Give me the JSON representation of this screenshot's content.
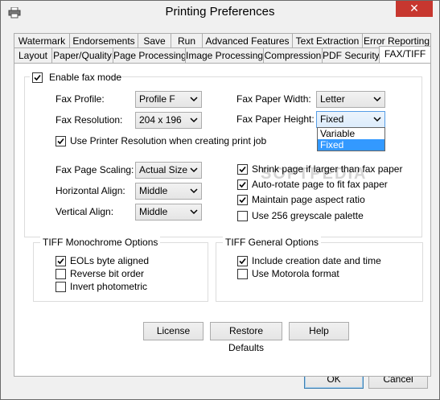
{
  "window": {
    "title": "Printing Preferences",
    "close_glyph": "✕"
  },
  "tabs_row1": [
    "Watermark",
    "Endorsements",
    "Save",
    "Run",
    "Advanced Features",
    "Text Extraction",
    "Error Reporting"
  ],
  "tabs_row2": [
    "Layout",
    "Paper/Quality",
    "Page Processing",
    "Image Processing",
    "Compression",
    "PDF Security",
    "FAX/TIFF"
  ],
  "active_tab": "FAX/TIFF",
  "fax": {
    "enable_label": "Enable fax mode",
    "enable_checked": true,
    "profile_label": "Fax Profile:",
    "profile_value": "Profile F",
    "resolution_label": "Fax Resolution:",
    "resolution_value": "204 x 196",
    "paper_width_label": "Fax Paper Width:",
    "paper_width_value": "Letter",
    "paper_height_label": "Fax Paper Height:",
    "paper_height_value": "Fixed",
    "paper_height_options": [
      "Variable",
      "Fixed"
    ],
    "paper_height_selected": "Fixed",
    "use_printer_res_label": "Use Printer Resolution when creating print job",
    "use_printer_res_checked": true,
    "scaling_label": "Fax Page Scaling:",
    "scaling_value": "Actual Size",
    "halign_label": "Horizontal Align:",
    "halign_value": "Middle",
    "valign_label": "Vertical Align:",
    "valign_value": "Middle",
    "shrink_label": "Shrink page if larger than fax paper",
    "shrink_checked": true,
    "autorotate_label": "Auto-rotate page to fit fax paper",
    "autorotate_checked": true,
    "aspect_label": "Maintain page aspect ratio",
    "aspect_checked": true,
    "greyscale_label": "Use 256 greyscale palette",
    "greyscale_checked": false
  },
  "tiff_mono": {
    "title": "TIFF Monochrome Options",
    "eols_label": "EOLs byte aligned",
    "eols_checked": true,
    "reverse_label": "Reverse bit order",
    "reverse_checked": false,
    "invert_label": "Invert photometric",
    "invert_checked": false
  },
  "tiff_general": {
    "title": "TIFF General Options",
    "creation_label": "Include creation date and time",
    "creation_checked": true,
    "motorola_label": "Use Motorola format",
    "motorola_checked": false
  },
  "buttons": {
    "license": "License",
    "restore": "Restore Defaults",
    "help": "Help",
    "ok": "OK",
    "cancel": "Cancel"
  },
  "watermark_text": "SOFTPEDIA",
  "icons": {
    "app": "printer-icon",
    "check": "checkmark-icon",
    "arrow": "chevron-down-icon",
    "close": "close-icon"
  },
  "colors": {
    "close_button": "#c7372f",
    "selection": "#3399ff",
    "focus_border": "#569de5"
  }
}
